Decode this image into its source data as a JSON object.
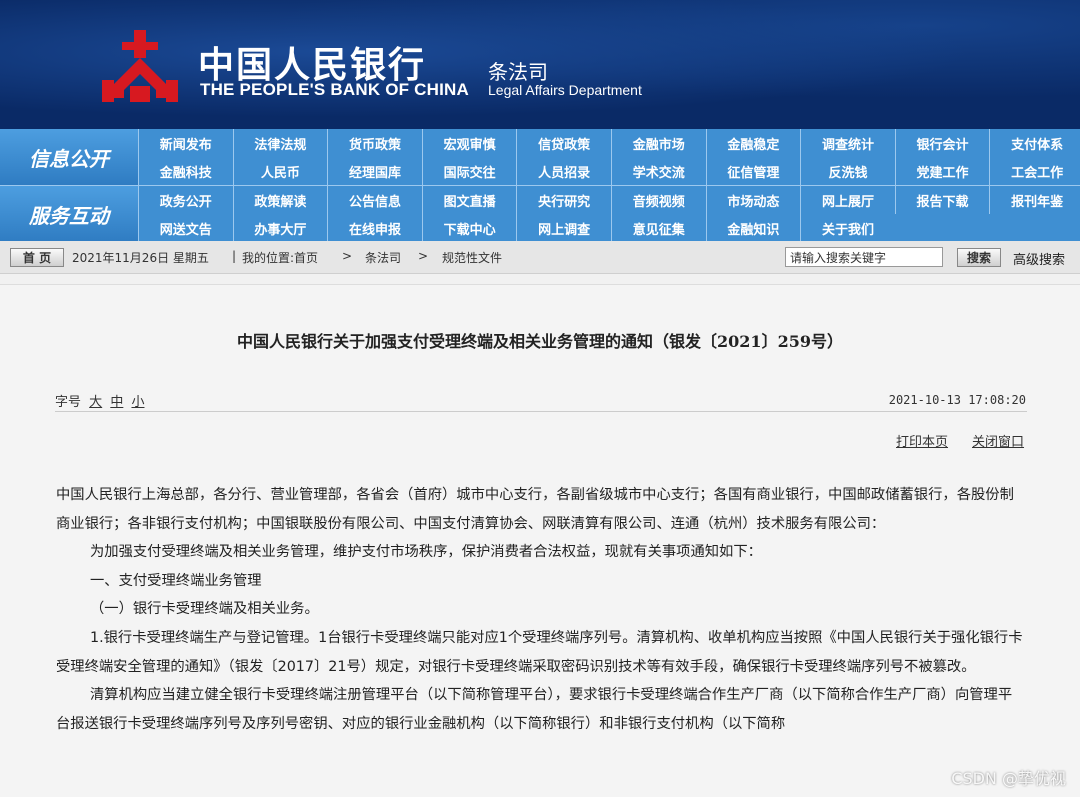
{
  "header": {
    "bank_name_cn": "中国人民银行",
    "bank_name_en": "THE PEOPLE'S BANK OF CHINA",
    "dept_cn": "条法司",
    "dept_en": "Legal Affairs Department",
    "logo_icon": "pboc-logo-icon",
    "brand_color": "#0a2a66",
    "logo_color": "#d71920"
  },
  "nav": {
    "group1_label": "信息公开",
    "group2_label": "服务互动",
    "row1": [
      "新闻发布",
      "法律法规",
      "货币政策",
      "宏观审慎",
      "信贷政策",
      "金融市场",
      "金融稳定",
      "调查统计",
      "银行会计",
      "支付体系"
    ],
    "row2": [
      "金融科技",
      "人民币",
      "经理国库",
      "国际交往",
      "人员招录",
      "学术交流",
      "征信管理",
      "反洗钱",
      "党建工作",
      "工会工作"
    ],
    "row3": [
      "政务公开",
      "政策解读",
      "公告信息",
      "图文直播",
      "央行研究",
      "音频视频",
      "市场动态",
      "网上展厅",
      "报告下载",
      "报刊年鉴"
    ],
    "row4": [
      "网送文告",
      "办事大厅",
      "在线申报",
      "下载中心",
      "网上调查",
      "意见征集",
      "金融知识",
      "关于我们"
    ],
    "bg_color": "#3f8fd2"
  },
  "breadcrumb": {
    "home_label": "首 页",
    "date": "2021年11月26日  星期五",
    "location": "我的位置:首页",
    "level1": "条法司",
    "level2": "规范性文件",
    "separator": ">",
    "divider": "|"
  },
  "search": {
    "value": "请输入搜索关键字",
    "button_label": "搜索",
    "advanced_label": "高级搜索"
  },
  "article": {
    "title": "中国人民银行关于加强支付受理终端及相关业务管理的通知（银发〔2021〕259号）",
    "font_size_label": "字号",
    "font_large": "大",
    "font_medium": "中",
    "font_small": "小",
    "timestamp": "2021-10-13 17:08:20",
    "print_label": "打印本页",
    "close_label": "关闭窗口",
    "paragraphs": [
      "中国人民银行上海总部，各分行、营业管理部，各省会（首府）城市中心支行，各副省级城市中心支行；各国有商业银行，中国邮政储蓄银行，各股份制商业银行；各非银行支付机构；中国银联股份有限公司、中国支付清算协会、网联清算有限公司、连通（杭州）技术服务有限公司：",
      "为加强支付受理终端及相关业务管理，维护支付市场秩序，保护消费者合法权益，现就有关事项通知如下：",
      "一、支付受理终端业务管理",
      "（一）银行卡受理终端及相关业务。",
      "1.银行卡受理终端生产与登记管理。1台银行卡受理终端只能对应1个受理终端序列号。清算机构、收单机构应当按照《中国人民银行关于强化银行卡受理终端安全管理的通知》（银发〔2017〕21号）规定，对银行卡受理终端采取密码识别技术等有效手段，确保银行卡受理终端序列号不被篡改。",
      "清算机构应当建立健全银行卡受理终端注册管理平台（以下简称管理平台），要求银行卡受理终端合作生产厂商（以下简称合作生产厂商）向管理平台报送银行卡受理终端序列号及序列号密钥、对应的银行业金融机构（以下简称银行）和非银行支付机构（以下简称"
    ]
  },
  "watermark": "CSDN @挚优视"
}
